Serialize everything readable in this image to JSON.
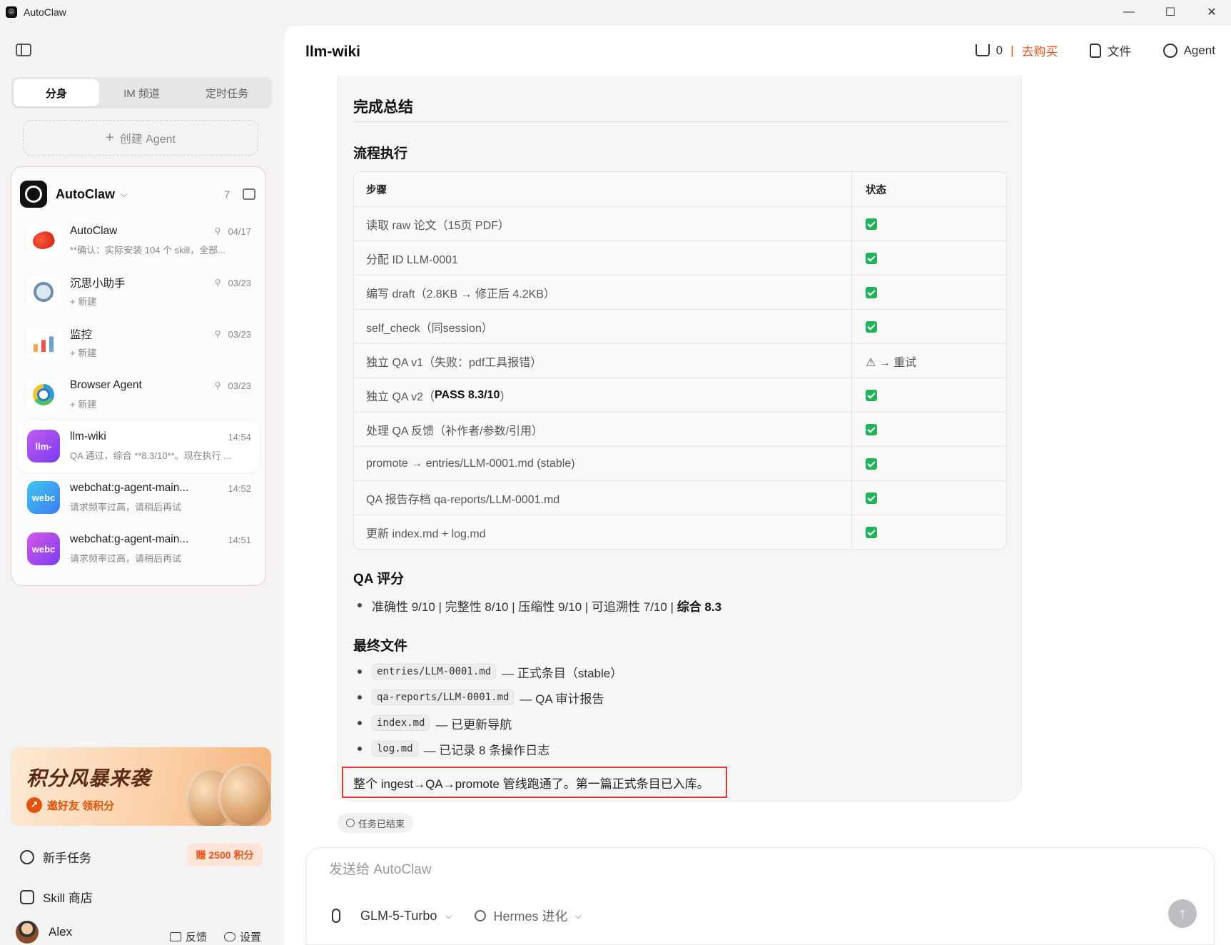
{
  "window": {
    "title": "AutoClaw",
    "controls": {
      "minimize": "—",
      "maximize": "☐",
      "close": "✕"
    }
  },
  "sidebar": {
    "tabs": [
      {
        "label": "分身",
        "active": true
      },
      {
        "label": "IM 频道",
        "active": false
      },
      {
        "label": "定时任务",
        "active": false
      }
    ],
    "create_agent": {
      "plus": "+",
      "label": "创建 Agent"
    },
    "agent_group": {
      "name": "AutoClaw",
      "chevron": "⌵",
      "count": "7"
    },
    "agents": [
      {
        "name": "AutoClaw",
        "pin": "⚲",
        "time": "04/17",
        "preview": "**确认：实际安装 104 个 skill，全部...",
        "avatar": "lobster-icon"
      },
      {
        "name": "沉思小助手",
        "pin": "⚲",
        "time": "03/23",
        "preview": "+ 新建",
        "avatar": "magnifier-icon"
      },
      {
        "name": "监控",
        "pin": "⚲",
        "time": "03/23",
        "preview": "+ 新建",
        "avatar": "chart-icon"
      },
      {
        "name": "Browser Agent",
        "pin": "⚲",
        "time": "03/23",
        "preview": "+ 新建",
        "avatar": "browser-icon"
      },
      {
        "name": "llm-wiki",
        "time": "14:54",
        "preview": "QA 通过，综合 **8.3/10**。现在执行 ...",
        "avatar_text": "llm-",
        "selected": true
      },
      {
        "name": "webchat:g-agent-main...",
        "time": "14:52",
        "preview": "请求频率过高，请稍后再试",
        "avatar_text": "webc"
      },
      {
        "name": "webchat:g-agent-main...",
        "time": "14:51",
        "preview": "请求频率过高，请稍后再试",
        "avatar_text": "webc"
      }
    ],
    "promo": {
      "title": "积分风暴来袭",
      "cta": "邀好友 领积分",
      "arrow": "↗"
    },
    "newbie_task": {
      "label": "新手任务",
      "badge": "赚 2500 积分"
    },
    "skill_store": {
      "label": "Skill 商店"
    },
    "user": {
      "name": "Alex"
    },
    "feedback": "反馈",
    "settings": "设置"
  },
  "header": {
    "title": "llm-wiki",
    "cart_count": "0",
    "cart_sep": "|",
    "cart_buy": "去购买",
    "files": "文件",
    "agent": "Agent"
  },
  "message": {
    "summary_title": "完成总结",
    "flow_title": "流程执行",
    "table": {
      "headers": [
        "步骤",
        "状态"
      ],
      "rows": [
        {
          "step": "读取 raw 论文（15页 PDF）",
          "status": "check"
        },
        {
          "step": "分配 ID LLM-0001",
          "status": "check"
        },
        {
          "step": "编写 draft（2.8KB → 修正后 4.2KB）",
          "status": "check"
        },
        {
          "step": "self_check（同session）",
          "status": "check"
        },
        {
          "step": "独立 QA v1（失败：pdf工具报错）",
          "status": "text",
          "status_text": "⚠ → 重试"
        },
        {
          "step_prefix": "独立 QA v2（",
          "step_bold": "PASS 8.3/10",
          "step_suffix": "）",
          "status": "check"
        },
        {
          "step": "处理 QA 反馈（补作者/参数/引用）",
          "status": "check"
        },
        {
          "step": "promote → entries/LLM-0001.md (stable)",
          "status": "check"
        },
        {
          "step": "QA 报告存档 qa-reports/LLM-0001.md",
          "status": "check"
        },
        {
          "step": "更新 index.md + log.md",
          "status": "check"
        }
      ]
    },
    "qa_title": "QA 评分",
    "qa_line": "准确性 9/10 | 完整性 8/10 | 压缩性 9/10 | 可追溯性 7/10 | ",
    "qa_total": "综合 8.3",
    "files_title": "最终文件",
    "files": [
      {
        "code": "entries/LLM-0001.md",
        "desc": "— 正式条目（stable）"
      },
      {
        "code": "qa-reports/LLM-0001.md",
        "desc": "— QA 审计报告"
      },
      {
        "code": "index.md",
        "desc": "— 已更新导航"
      },
      {
        "code": "log.md",
        "desc": "— 已记录 8 条操作日志"
      }
    ],
    "conclusion": "整个 ingest→QA→promote 管线跑通了。第一篇正式条目已入库。"
  },
  "status_pill": "任务已结束",
  "composer": {
    "placeholder": "发送给 AutoClaw",
    "model": "GLM-5-Turbo",
    "mode": "Hermes 进化",
    "chevron": "⌵",
    "send": "↑"
  }
}
